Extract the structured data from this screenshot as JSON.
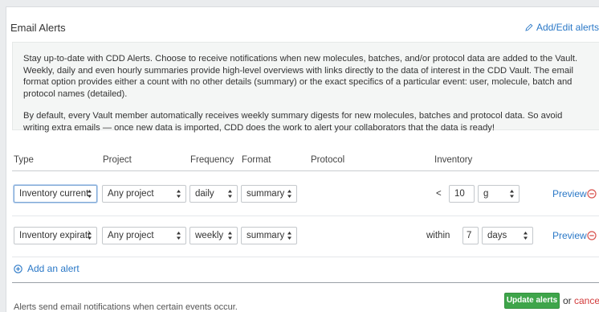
{
  "header": {
    "title": "Email Alerts",
    "edit_link": "Add/Edit alerts"
  },
  "info": {
    "paragraph1": "Stay up-to-date with CDD Alerts. Choose to receive notifications when new molecules, batches, and/or protocol data are added to the Vault. Weekly, daily and even hourly summaries provide high-level overviews with links directly to the data of interest in the CDD Vault. The email format option provides either a count with no other details (summary) or the exact specifics of a particular event: user, molecule, batch and protocol names (detailed).",
    "paragraph2": "By default, every Vault member automatically receives weekly summary digests for new molecules, batches and protocol data. So avoid writing extra emails — once new data is imported, CDD does the work to alert your collaborators that the data is ready!"
  },
  "columns": {
    "type": "Type",
    "project": "Project",
    "frequency": "Frequency",
    "format": "Format",
    "protocol": "Protocol",
    "inventory": "Inventory"
  },
  "alerts": [
    {
      "type": "Inventory current",
      "project": "Any project",
      "frequency": "daily",
      "format": "summary",
      "inventory_op": "<",
      "inventory_value": "10",
      "inventory_unit": "g",
      "preview": "Preview"
    },
    {
      "type": "Inventory expirati",
      "project": "Any project",
      "frequency": "weekly",
      "format": "summary",
      "inventory_op": "within",
      "inventory_value": "7",
      "inventory_unit": "days",
      "preview": "Preview"
    }
  ],
  "add_alert": "Add an alert",
  "footer": {
    "note": "Alerts send email notifications when certain events occur.",
    "update_button": "Update alerts",
    "or": "or",
    "cancel": "cancel"
  },
  "colors": {
    "link": "#2a78c7",
    "update_green": "#3ea54a",
    "cancel_red": "#d23a3a",
    "remove_red": "#d9534f"
  },
  "icons": {
    "edit": "pencil-icon",
    "remove": "minus-circle-icon",
    "add": "plus-circle-icon",
    "select_arrows": "up-down-arrows-icon"
  }
}
